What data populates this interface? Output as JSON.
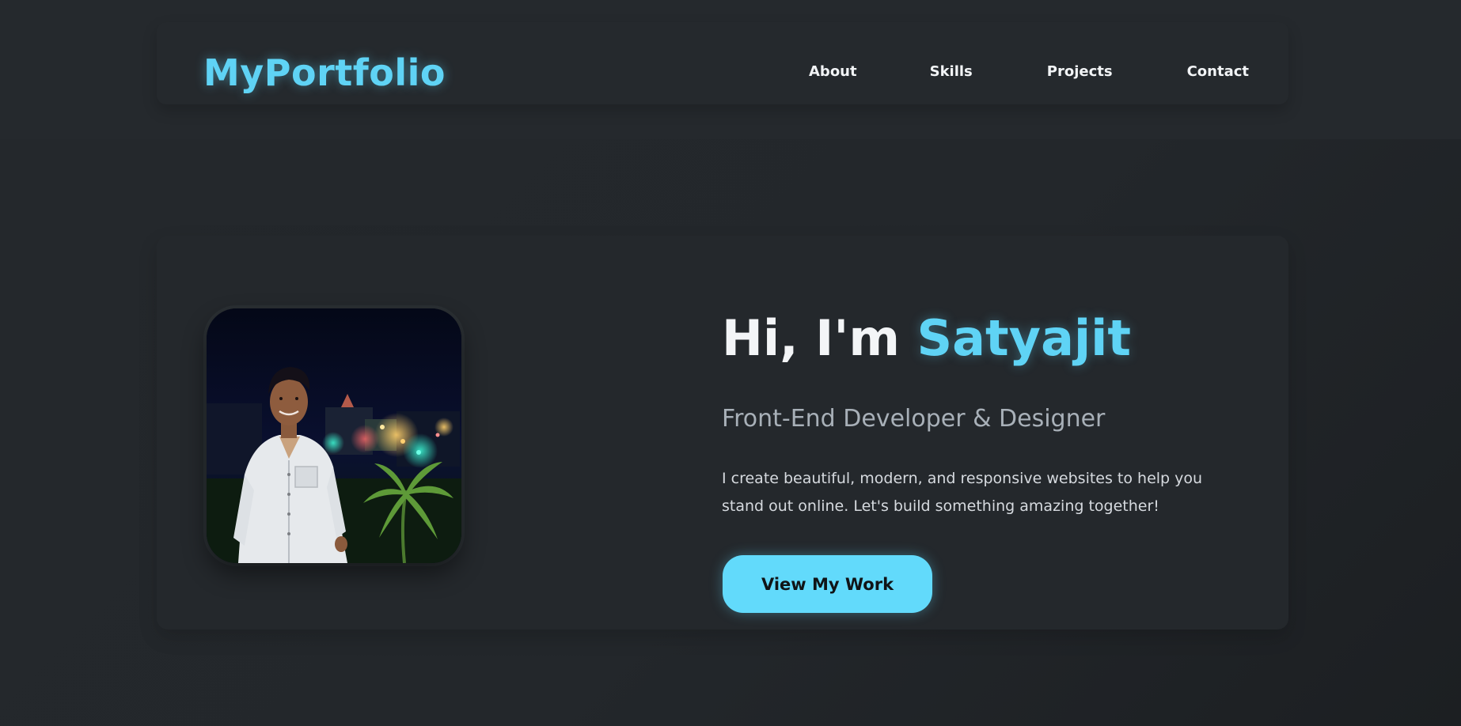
{
  "header": {
    "logo": "MyPortfolio",
    "nav": [
      {
        "label": "About"
      },
      {
        "label": "Skills"
      },
      {
        "label": "Projects"
      },
      {
        "label": "Contact"
      }
    ]
  },
  "hero": {
    "greeting": "Hi, I'm ",
    "name": "Satyajit",
    "subtitle": "Front-End Developer & Designer",
    "description": "I create beautiful, modern, and responsive websites to help you stand out online. Let's build something amazing together!",
    "cta_label": "View My Work"
  },
  "colors": {
    "accent": "#5fd3f5",
    "background": "#24282c",
    "button": "#62dafb",
    "text": "#f3f5f7"
  }
}
